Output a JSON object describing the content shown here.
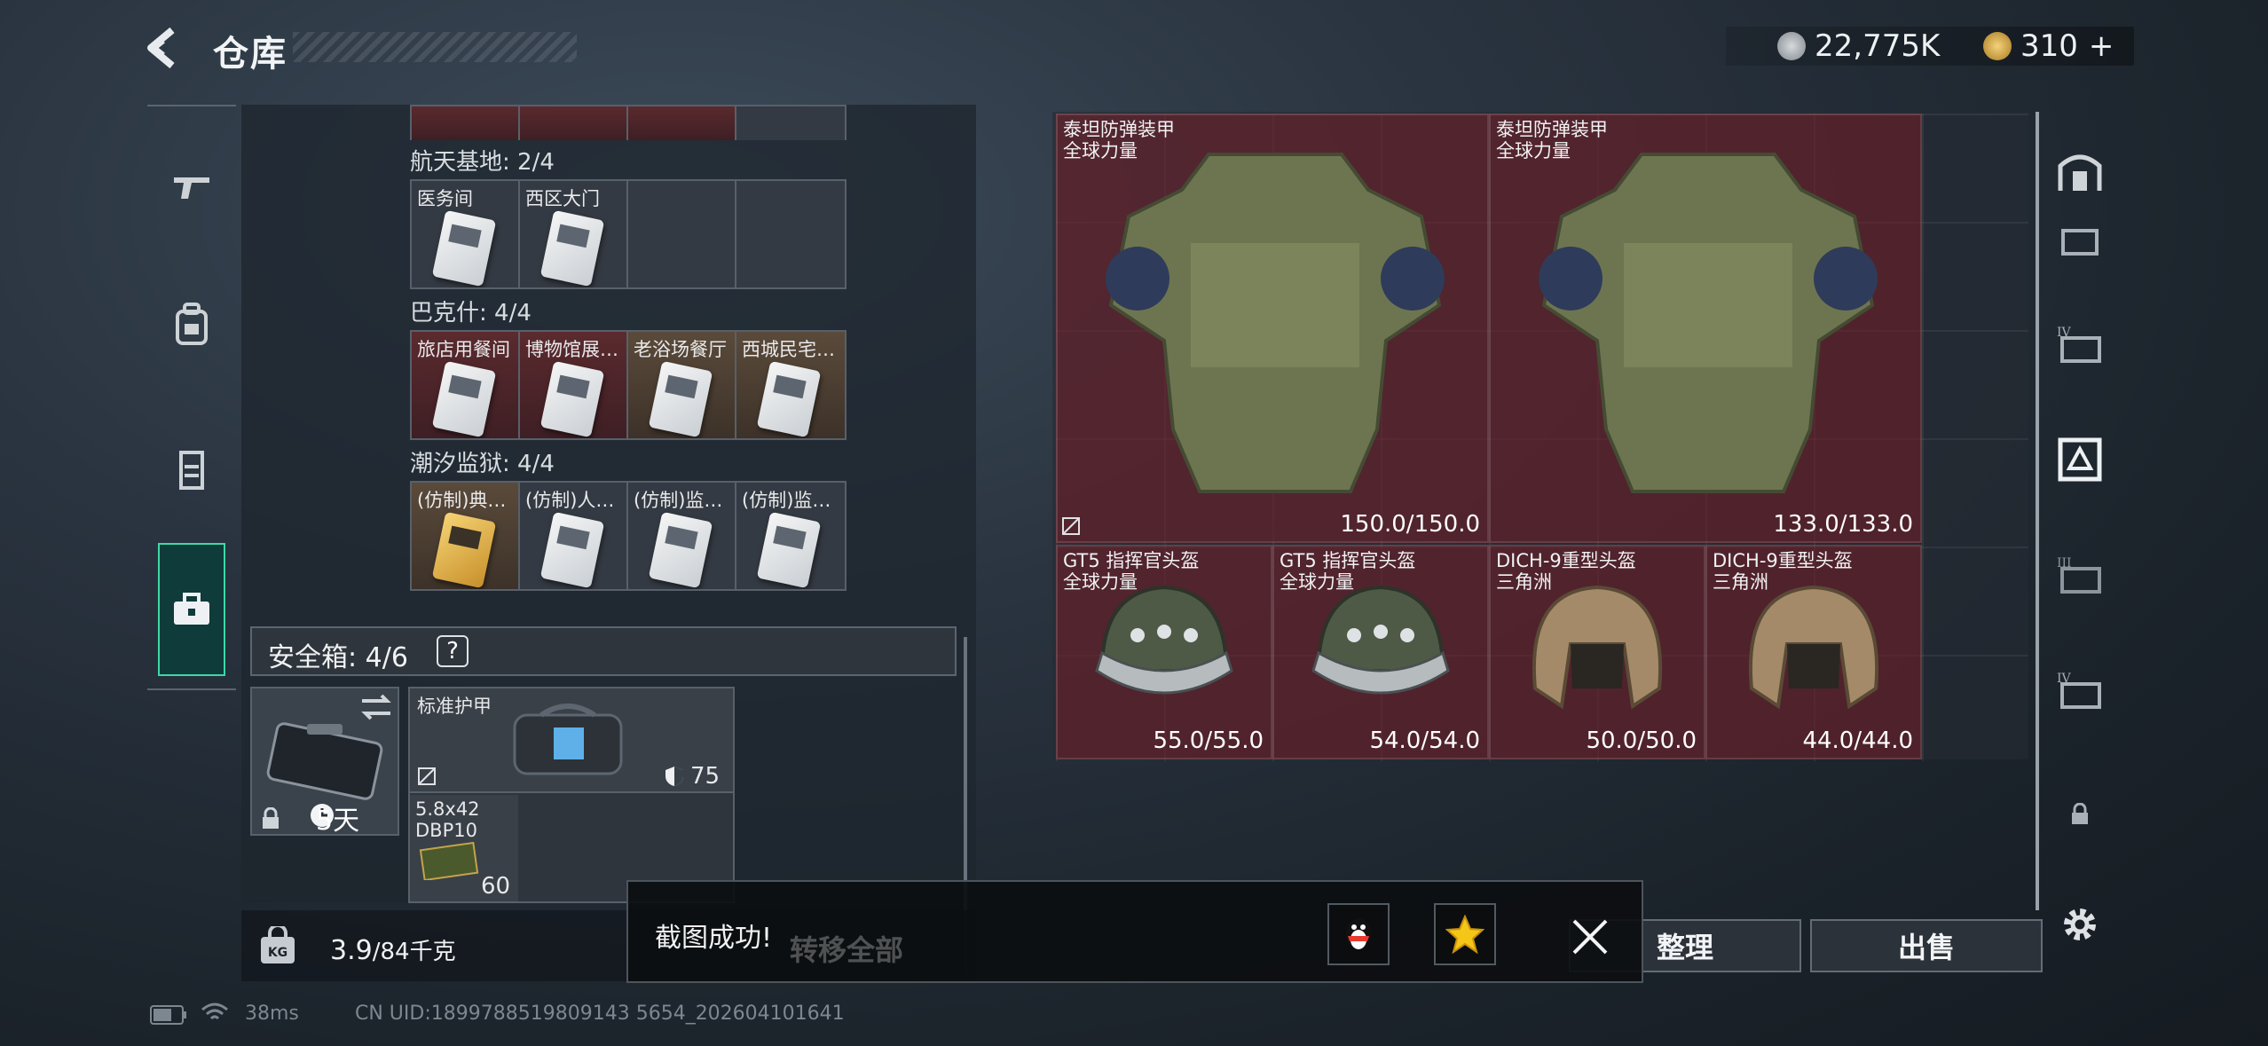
{
  "header": {
    "title": "仓库",
    "currency_1": "22,775K",
    "currency_2": "310",
    "currency_2_add": "+"
  },
  "left_rail": {
    "items": [
      {
        "icon": "rifle-icon"
      },
      {
        "icon": "backpack-icon"
      },
      {
        "icon": "vest-icon"
      },
      {
        "icon": "toolbox-icon",
        "active": true
      }
    ]
  },
  "sections": [
    {
      "label": "航天基地: 2/4",
      "cards": [
        "医务间",
        "西区大门",
        "",
        ""
      ]
    },
    {
      "label": "巴克什: 4/4",
      "cards": [
        "旅店用餐间",
        "博物馆展…",
        "老浴场餐厅",
        "西城民宅…"
      ]
    },
    {
      "label": "潮汐监狱: 4/4",
      "cards": [
        "(仿制)典…",
        "(仿制)人…",
        "(仿制)监…",
        "(仿制)监…"
      ]
    }
  ],
  "safe_box": {
    "label": "安全箱: 4/6",
    "help": "?",
    "days": "5天",
    "armor_name": "标准护甲",
    "armor_value": "75",
    "ammo_name": "5.8x42\nDBP10",
    "ammo_count": "60"
  },
  "bottom_bar": {
    "weight": "3.9",
    "weight_max": "/84千克",
    "transfer_all": "转移全部"
  },
  "right_items": [
    {
      "name": "泰坦防弹装甲\n全球力量",
      "durability": "150.0/150.0"
    },
    {
      "name": "泰坦防弹装甲\n全球力量",
      "durability": "133.0/133.0"
    },
    {
      "name": "GT5 指挥官头盔\n全球力量",
      "durability": "55.0/55.0"
    },
    {
      "name": "GT5 指挥官头盔\n全球力量",
      "durability": "54.0/54.0"
    },
    {
      "name": "DICH-9重型头盔\n三角洲",
      "durability": "50.0/50.0"
    },
    {
      "name": "DICH-9重型头盔\n三角洲",
      "durability": "44.0/44.0"
    }
  ],
  "actions": {
    "organize": "整理",
    "sell": "出售"
  },
  "toast": {
    "text": "截图成功!"
  },
  "footer": {
    "ping": "38ms",
    "uid": "CN UID:1899788519809143 5654_202604101641"
  },
  "colors": {
    "accent": "#3dd9a8",
    "item_red": "#6e1e28"
  }
}
